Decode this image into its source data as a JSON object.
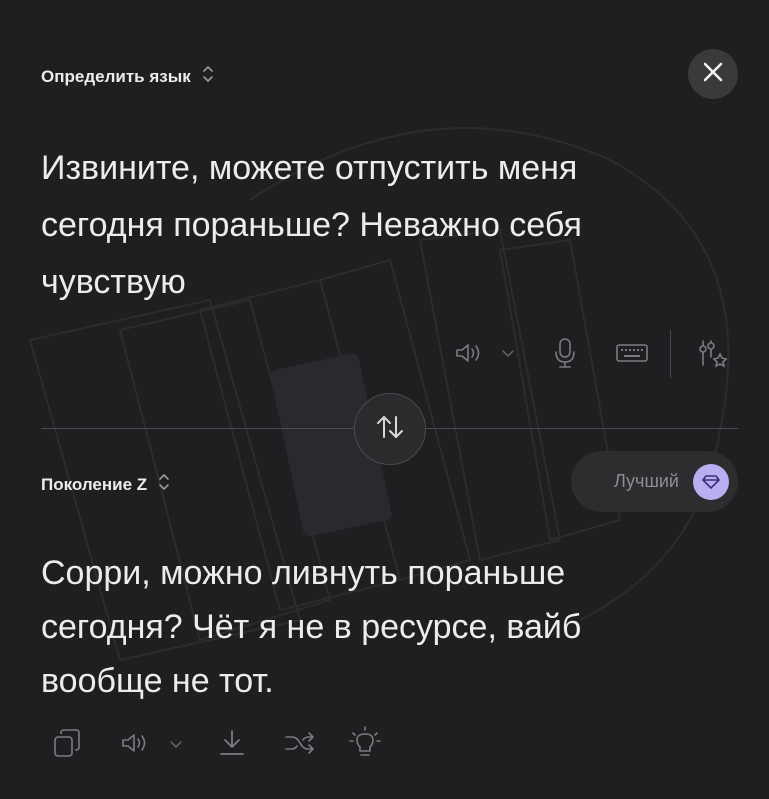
{
  "source": {
    "language_label": "Определить язык",
    "text": "Извините, можете отпустить меня сегодня пораньше? Неважно себя чувствую"
  },
  "target": {
    "style_label": "Поколение Z",
    "quality_label": "Лучший",
    "text": "Сорри, можно ливнуть пораньше сегодня? Чёт я не в ресурсе, вайб вообще не тот."
  },
  "icons": {
    "close": "close-icon",
    "source_toolbar": [
      "speaker-icon",
      "chevron-down-icon",
      "microphone-icon",
      "keyboard-icon",
      "settings-sparkle-icon"
    ],
    "swap": "swap-arrows-icon",
    "quality": "gem-icon",
    "result_toolbar": [
      "copy-icon",
      "speaker-icon",
      "chevron-down-icon",
      "download-icon",
      "shuffle-icon",
      "lightbulb-icon"
    ]
  },
  "colors": {
    "background": "#1f1f21",
    "text": "#ececee",
    "muted_icon": "#7c7c80",
    "gem_accent": "#b8aef0",
    "pill_bg": "#2d2d30"
  }
}
